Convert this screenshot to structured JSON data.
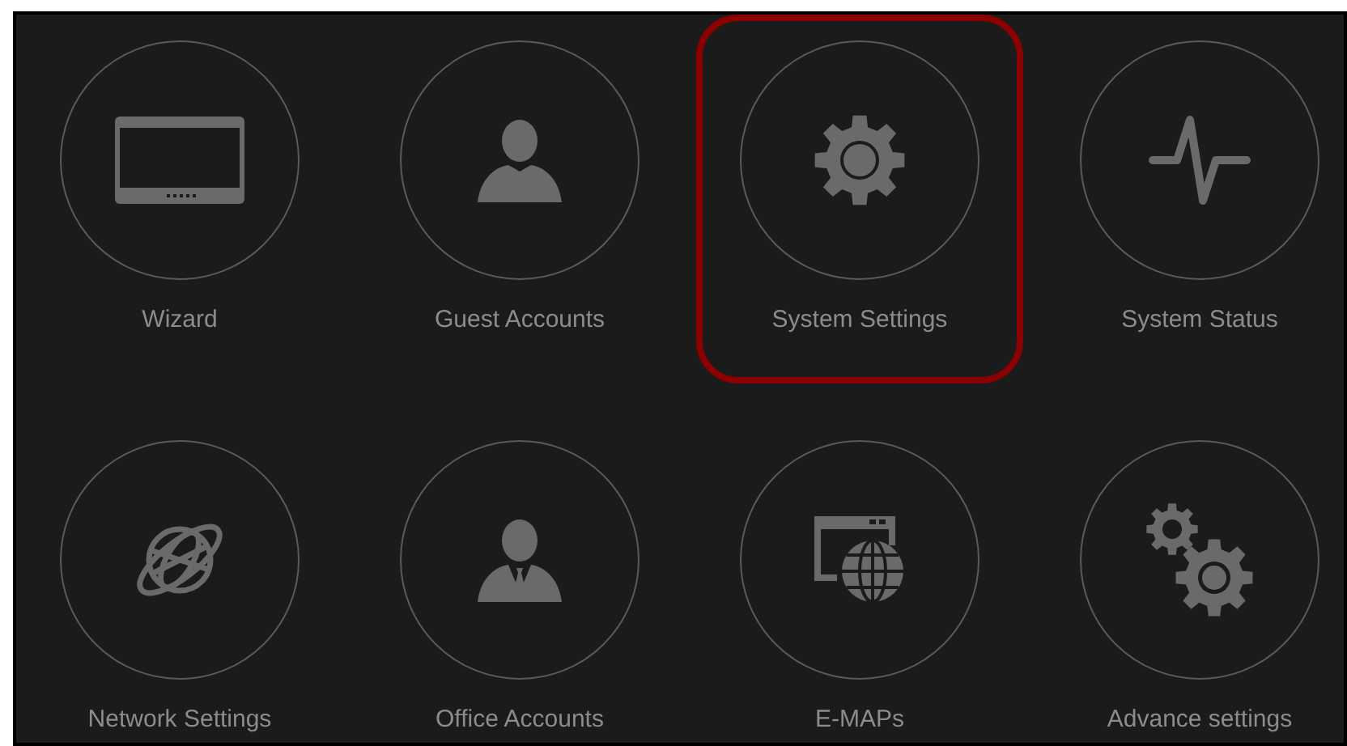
{
  "tiles": [
    {
      "kind": "tablet",
      "label": "Wizard",
      "highlighted": false
    },
    {
      "kind": "user",
      "label": "Guest Accounts",
      "highlighted": false
    },
    {
      "kind": "gear",
      "label": "System Settings",
      "highlighted": true
    },
    {
      "kind": "pulse",
      "label": "System Status",
      "highlighted": false
    },
    {
      "kind": "globe",
      "label": "Network Settings",
      "highlighted": false
    },
    {
      "kind": "businessman",
      "label": "Office Accounts",
      "highlighted": false
    },
    {
      "kind": "webglobe",
      "label": "E-MAPs",
      "highlighted": false
    },
    {
      "kind": "gears",
      "label": "Advance settings",
      "highlighted": false
    }
  ]
}
